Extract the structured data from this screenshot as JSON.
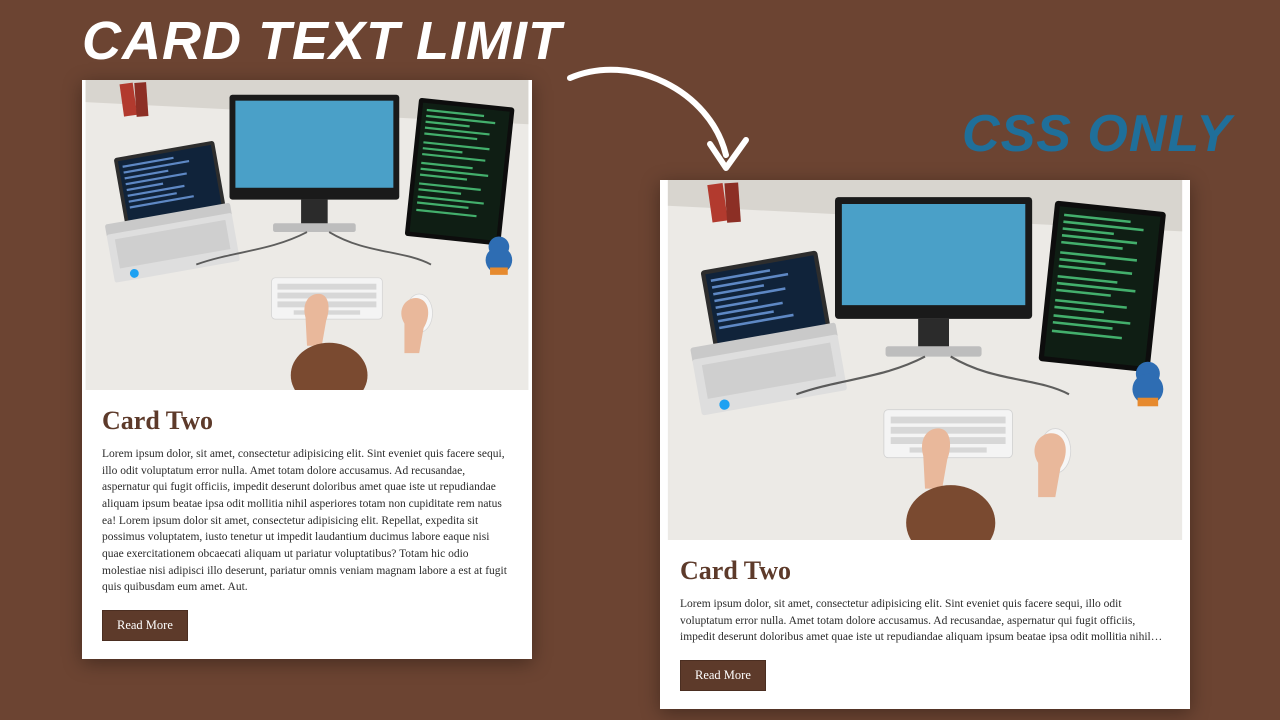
{
  "colors": {
    "bg": "#6c4432",
    "accent": "#5d3a2a",
    "css_label": "#1f6f9a"
  },
  "headline_left": "CARD TEXT LIMIT",
  "headline_right": "CSS ONLY",
  "cards": {
    "left": {
      "title": "Card Two",
      "body": "Lorem ipsum dolor, sit amet, consectetur adipisicing elit. Sint eveniet quis facere sequi, illo odit voluptatum error nulla. Amet totam dolore accusamus. Ad recusandae, aspernatur qui fugit officiis, impedit deserunt doloribus amet quae iste ut repudiandae aliquam ipsum beatae ipsa odit mollitia nihil asperiores totam non cupiditate rem natus ea! Lorem ipsum dolor sit amet, consectetur adipisicing elit. Repellat, expedita sit possimus voluptatem, iusto tenetur ut impedit laudantium ducimus labore eaque nisi quae exercitationem obcaecati aliquam ut pariatur voluptatibus? Totam hic odio molestiae nisi adipisci illo deserunt, pariatur omnis veniam magnam labore a est at fugit quis quibusdam eum amet. Aut.",
      "button": "Read More"
    },
    "right": {
      "title": "Card Two",
      "body": "Lorem ipsum dolor, sit amet, consectetur adipisicing elit. Sint eveniet quis facere sequi, illo odit voluptatum error nulla. Amet totam dolore accusamus. Ad recusandae, aspernatur qui fugit officiis, impedit deserunt doloribus amet quae iste ut repudiandae aliquam ipsum beatae ipsa odit mollitia nihil asperiores totam",
      "button": "Read More"
    }
  }
}
